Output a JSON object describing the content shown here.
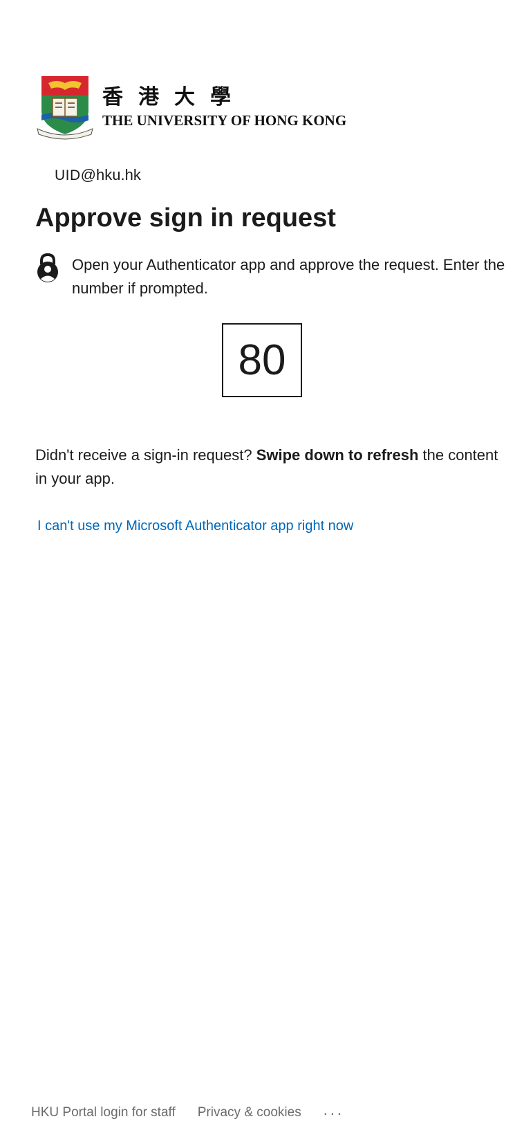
{
  "logo": {
    "chinese_name": "香港大學",
    "english_name": "THE UNIVERSITY OF HONG KONG"
  },
  "identity": {
    "uid_label": "UID",
    "domain": "@hku.hk"
  },
  "title": "Approve sign in request",
  "instruction": {
    "icon": "lock-user-icon",
    "text": "Open your Authenticator app and approve the request. Enter the number if prompted."
  },
  "number": "80",
  "refresh_note": {
    "prefix": "Didn't receive a sign-in request? ",
    "bold": "Swipe down to refresh",
    "suffix": " the content in your app."
  },
  "alt_link": "I can't use my Microsoft Authenticator app right now",
  "footer": {
    "portal_link": "HKU Portal login for staff",
    "privacy_link": "Privacy & cookies",
    "more": "..."
  },
  "colors": {
    "link": "#0067b8",
    "text": "#1b1b1b",
    "footer": "#6b6b6b"
  }
}
